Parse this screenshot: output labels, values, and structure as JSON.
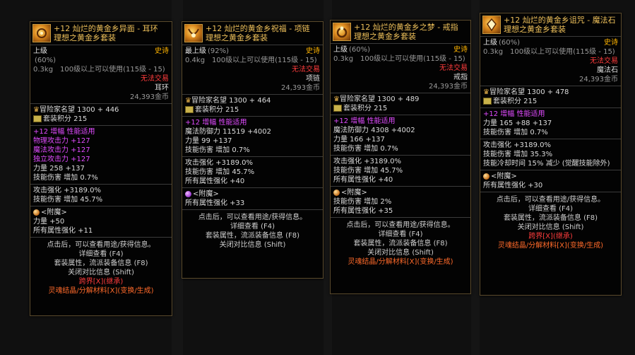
{
  "cards": [
    {
      "id": "earring",
      "title": "+12 灿烂的黄金乡异面 - 耳环",
      "set_name": "理想之黄金乡套装",
      "grade": "上级",
      "grade_pct": "(60%)",
      "rarity": "史诗",
      "weight": "0.3kg",
      "req": "100级以上可以使用(115级 - 15)",
      "trade": "无法交易",
      "type": "耳环",
      "price": "24,393金币",
      "fame": "冒险家名望 1300 + 446",
      "set_points": "套装积分 215",
      "amp": "+12 增幅 性能适用",
      "stats": [
        {
          "text": "物理攻击力 +127",
          "cls": "magenta"
        },
        {
          "text": "魔法攻击力 +127",
          "cls": "magenta"
        },
        {
          "text": "独立攻击力 +127",
          "cls": "magenta"
        },
        {
          "text": "力量 258 +137",
          "cls": "mix"
        },
        {
          "text": "技能伤害 增加 0.7%",
          "cls": "mix2"
        }
      ],
      "extra": [
        "攻击强化 +3189.0%",
        "技能伤害 增加 45.7%"
      ],
      "enchant_label": "<附魔>",
      "enchant": [
        "力量 +50",
        "所有属性强化 +11"
      ],
      "footer": [
        "点击后，可以查看用途/获得信息。",
        "详细查看 (F4)",
        "套装属性，流派装备信息 (F8)",
        "关闭对比信息 (Shift)",
        "跨界[X](继承)",
        "灵魂结晶/分解材料[X](变换/生成)"
      ]
    },
    {
      "id": "necklace",
      "title": "+12 灿烂的黄金乡祝福 - 项链",
      "set_name": "理想之黄金乡套装",
      "grade": "最上级",
      "grade_pct": "(92%)",
      "rarity": "史诗",
      "weight": "0.4kg",
      "req": "100级以上可以使用(115级 - 15)",
      "trade": "无法交易",
      "type": "项链",
      "price": "24,393金币",
      "fame": "冒险家名望 1300 + 464",
      "set_points": "套装积分 215",
      "amp": "+12 增幅 性能适用",
      "stats": [
        {
          "text": "魔法防御力 11519 +4002",
          "cls": "mix3"
        },
        {
          "text": "力量 99 +137",
          "cls": "mix"
        },
        {
          "text": "技能伤害 增加 0.7%",
          "cls": "mix2"
        }
      ],
      "extra": [
        "攻击强化 +3189.0%",
        "技能伤害 增加 45.7%",
        "所有属性强化 +40"
      ],
      "enchant_label": "<附魔>",
      "enchant": [
        "所有属性强化 +33"
      ],
      "footer": [
        "点击后，可以查看用途/获得信息。",
        "详细查看 (F4)",
        "套装属性，流派装备信息 (F8)",
        "关闭对比信息 (Shift)"
      ]
    },
    {
      "id": "ring",
      "title": "+12 灿烂的黄金乡之梦 - 戒指",
      "set_name": "理想之黄金乡套装",
      "grade": "上级",
      "grade_pct": "(60%)",
      "rarity": "史诗",
      "weight": "0.3kg",
      "req": "100级以上可以使用(115级 - 15)",
      "trade": "无法交易",
      "type": "戒指",
      "price": "24,393金币",
      "fame": "冒险家名望 1300 + 489",
      "set_points": "套装积分 215",
      "amp": "+12 增幅 性能适用",
      "stats": [
        {
          "text": "魔法防御力 4308 +4002",
          "cls": "mix3"
        },
        {
          "text": "力量 166 +137",
          "cls": "mix"
        },
        {
          "text": "技能伤害 增加 0.7%",
          "cls": "mix2"
        }
      ],
      "extra": [
        "攻击强化 +3189.0%",
        "技能伤害 增加 45.7%",
        "所有属性强化 +40"
      ],
      "enchant_label": "<附魔>",
      "enchant": [
        "技能伤害 增加 2%",
        "所有属性强化 +35"
      ],
      "footer": [
        "点击后，可以查看用途/获得信息。",
        "详细查看 (F4)",
        "套装属性，流派装备信息 (F8)",
        "关闭对比信息 (Shift)",
        "灵魂结晶/分解材料[X](变换/生成)"
      ]
    },
    {
      "id": "magicstone",
      "title": "+12 灿烂的黄金乡诅咒 - 魔法石",
      "set_name": "理想之黄金乡套装",
      "grade": "上级",
      "grade_pct": "(60%)",
      "rarity": "史诗",
      "weight": "0.3kg",
      "req": "100级以上可以使用(115级 - 15)",
      "trade": "无法交易",
      "type": "魔法石",
      "price": "24,393金币",
      "fame": "冒险家名望 1300 + 478",
      "set_points": "套装积分 215",
      "amp": "+12 增幅 性能适用",
      "stats": [
        {
          "text": "力量 165 +88 +137",
          "cls": "mix4"
        },
        {
          "text": "技能伤害 增加 0.7%",
          "cls": "mix2"
        }
      ],
      "extra": [
        "攻击强化 +3189.0%",
        "技能伤害 增加 35.3%",
        "技能冷却时间 15% 减少 (觉醒技能除外)"
      ],
      "enchant_label": "<附魔>",
      "enchant": [
        "所有属性强化 +30"
      ],
      "footer": [
        "点击后，可以查看用途/获得信息。",
        "详细查看 (F4)",
        "套装属性，流派装备信息 (F8)",
        "关闭对比信息 (Shift)",
        "跨界[X](继承)",
        "灵魂结晶/分解材料[X](变换/生成)"
      ]
    }
  ]
}
